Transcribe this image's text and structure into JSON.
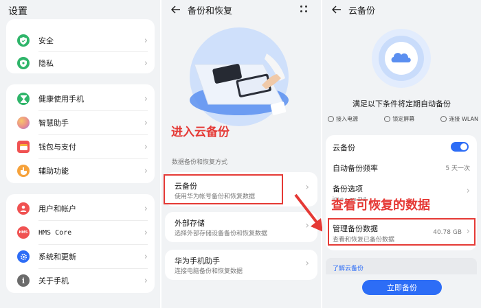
{
  "panel1": {
    "title": "设置",
    "group1": [
      {
        "label": "安全",
        "icon": "shield-icon",
        "color": "#2fb56a"
      },
      {
        "label": "隐私",
        "icon": "privacy-icon",
        "color": "#2fb56a"
      }
    ],
    "group2": [
      {
        "label": "健康使用手机",
        "icon": "hourglass-icon",
        "color": "#2fb56a"
      },
      {
        "label": "智慧助手",
        "icon": "assistant-icon",
        "color": "#e98d8d"
      },
      {
        "label": "钱包与支付",
        "icon": "wallet-icon",
        "color": "#f05252"
      },
      {
        "label": "辅助功能",
        "icon": "hand-icon",
        "color": "#f6a23b"
      }
    ],
    "group3": [
      {
        "label": "用户和帐户",
        "icon": "user-icon",
        "color": "#f05252"
      },
      {
        "label": "HMS Core",
        "icon": "hms-icon",
        "color": "#f05252"
      },
      {
        "label": "系统和更新",
        "icon": "gear-icon",
        "color": "#2d6df6"
      },
      {
        "label": "关于手机",
        "icon": "info-icon",
        "color": "#6b6b6b"
      }
    ]
  },
  "panel2": {
    "title": "备份和恢复",
    "annotation": "进入云备份",
    "section_label": "数据备份和恢复方式",
    "items": [
      {
        "title": "云备份",
        "subtitle": "使用华为帐号备份和恢复数据"
      },
      {
        "title": "外部存储",
        "subtitle": "选择外部存储设备备份和恢复数据"
      },
      {
        "title": "华为手机助手",
        "subtitle": "连接电脑备份和恢复数据"
      }
    ]
  },
  "panel3": {
    "title": "云备份",
    "heading": "满足以下条件将定期自动备份",
    "conditions": [
      {
        "label": "接入电源",
        "icon": "plug-icon"
      },
      {
        "label": "锁定屏幕",
        "icon": "lock-icon"
      },
      {
        "label": "连接 WLAN",
        "icon": "wifi-icon"
      }
    ],
    "cloud_backup_label": "云备份",
    "cloud_backup_on": true,
    "freq_label": "自动备份频率",
    "freq_value": "5 天一次",
    "options_label": "备份选项",
    "options_sub": "Ꭵꭑꮺ ꭸ ꮤꭶ ᎠᏰ",
    "annotation": "查看可恢复的数据",
    "manage_label": "管理备份数据",
    "manage_sub": "查看和恢复已备份数据",
    "manage_size": "40.78 GB",
    "learn_more": "了解云备份",
    "backup_now": "立即备份",
    "accent": "#2d6df6"
  },
  "colors": {
    "annotation_red": "#e53935",
    "page_bg": "#f1f3f5"
  }
}
